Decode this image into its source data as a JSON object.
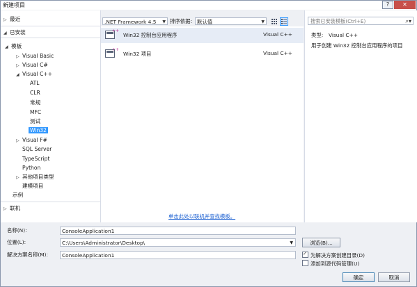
{
  "window": {
    "title": "新建项目",
    "help": "?",
    "close": "✕"
  },
  "tree": {
    "recent": "最近",
    "installed": "已安装",
    "templates": "模板",
    "items": [
      {
        "label": "Visual Basic"
      },
      {
        "label": "Visual C#"
      },
      {
        "label": "Visual C++"
      },
      {
        "label": "ATL"
      },
      {
        "label": "CLR"
      },
      {
        "label": "常规"
      },
      {
        "label": "MFC"
      },
      {
        "label": "测试"
      },
      {
        "label": "Win32"
      },
      {
        "label": "Visual F#"
      },
      {
        "label": "SQL Server"
      },
      {
        "label": "TypeScript"
      },
      {
        "label": "Python"
      },
      {
        "label": "其他项目类型"
      },
      {
        "label": "建模项目"
      }
    ],
    "samples": "示例",
    "online": "联机"
  },
  "toolbar": {
    "framework": ".NET Framework 4.5",
    "sort_label": "排序依据:",
    "sort_value": "默认值"
  },
  "templates": [
    {
      "name": "Win32 控制台应用程序",
      "lang": "Visual C++"
    },
    {
      "name": "Win32 项目",
      "lang": "Visual C++"
    }
  ],
  "online_link": "单击此处以联机并查找模板。",
  "search": {
    "placeholder": "搜索已安装模板(Ctrl+E)"
  },
  "details": {
    "type_label": "类型:",
    "type_value": "Visual C++",
    "description": "用于创建 Win32 控制台应用程序的项目"
  },
  "form": {
    "name_label": "名称(N):",
    "name_value": "ConsoleApplication1",
    "location_label": "位置(L):",
    "location_value": "C:\\Users\\Administrator\\Desktop\\",
    "solution_label": "解决方案名称(M):",
    "solution_value": "ConsoleApplication1",
    "browse": "浏览(B)...",
    "create_dir": "为解决方案创建目录(D)",
    "add_source_control": "添加到源代码管理(U)",
    "ok": "确定",
    "cancel": "取消"
  }
}
